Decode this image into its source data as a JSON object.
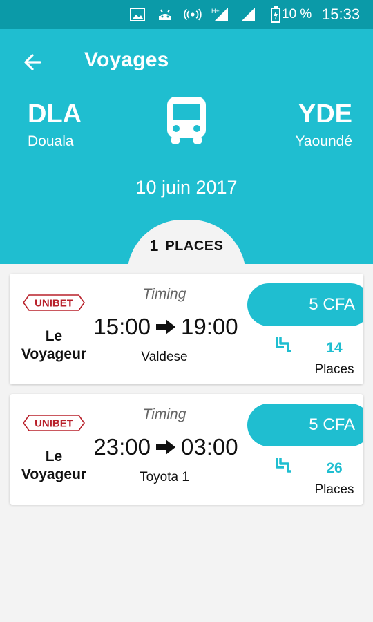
{
  "status_bar": {
    "battery": "10 %",
    "time": "15:33",
    "icons": [
      "image-icon",
      "android-icon",
      "hotspot-icon",
      "signal-h-icon",
      "signal-icon",
      "battery-charging-icon"
    ]
  },
  "header": {
    "title": "Voyages",
    "origin": {
      "code": "DLA",
      "name": "Douala"
    },
    "destination": {
      "code": "YDE",
      "name": "Yaoundé"
    },
    "date": "10 juin 2017",
    "places_count": "1",
    "places_label": "PLACES",
    "colors": {
      "accent": "#1fbed0",
      "status_bar": "#0b9aa8"
    }
  },
  "trips": [
    {
      "logo": "UNIBET",
      "operator": "Le Voyageur",
      "timing_label": "Timing",
      "depart": "15:00",
      "arrive": "19:00",
      "vehicle": "Valdese",
      "price": "5 CFA",
      "seats": "14",
      "seats_label": "Places"
    },
    {
      "logo": "UNIBET",
      "operator": "Le Voyageur",
      "timing_label": "Timing",
      "depart": "23:00",
      "arrive": "03:00",
      "vehicle": "Toyota 1",
      "price": "5 CFA",
      "seats": "26",
      "seats_label": "Places"
    }
  ]
}
